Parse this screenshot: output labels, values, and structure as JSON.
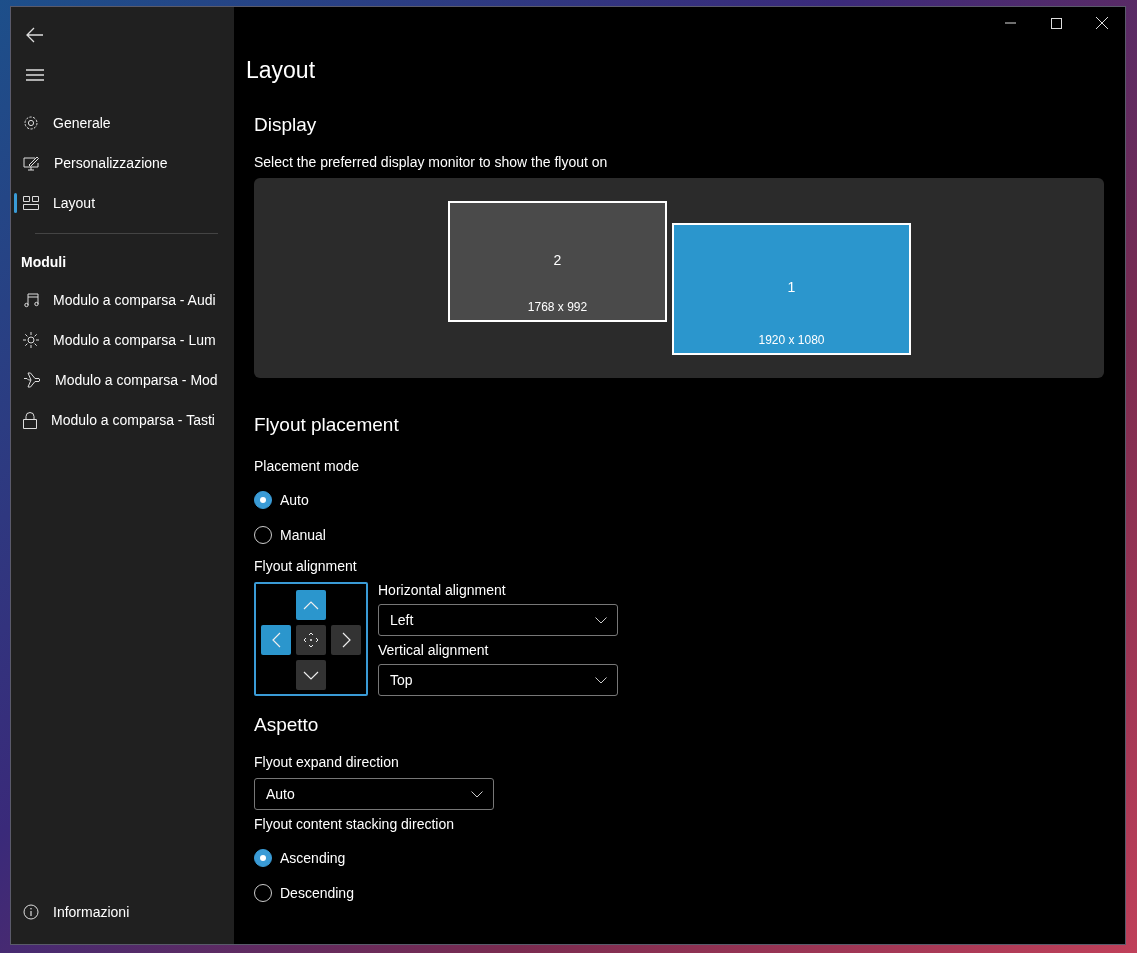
{
  "sidebar": {
    "nav_items": [
      {
        "label": "Generale",
        "kind": "gear",
        "selected": false
      },
      {
        "label": "Personalizzazione",
        "kind": "pen",
        "selected": false
      },
      {
        "label": "Layout",
        "kind": "layout",
        "selected": true
      }
    ],
    "section_label": "Moduli",
    "module_items": [
      {
        "label": "Modulo a comparsa - Audi",
        "kind": "music"
      },
      {
        "label": "Modulo a comparsa - Lum",
        "kind": "sun"
      },
      {
        "label": "Modulo a comparsa - Mod",
        "kind": "plane"
      },
      {
        "label": "Modulo a comparsa - Tasti",
        "kind": "lock"
      }
    ],
    "footer_item": {
      "label": "Informazioni"
    }
  },
  "page_title": "Layout",
  "display": {
    "heading": "Display",
    "description": "Select the preferred display monitor to show the flyout on",
    "monitors": [
      {
        "number": "2",
        "resolution": "1768 x 992",
        "selected": false
      },
      {
        "number": "1",
        "resolution": "1920 x 1080",
        "selected": true
      }
    ]
  },
  "flyout_placement": {
    "heading": "Flyout placement",
    "placement_mode_label": "Placement mode",
    "placement_modes": [
      {
        "label": "Auto",
        "selected": true
      },
      {
        "label": "Manual",
        "selected": false
      }
    ],
    "alignment_label": "Flyout alignment",
    "alignment_pad": [
      {
        "kind": "up",
        "selected": true
      },
      {
        "kind": "left",
        "selected": true
      },
      {
        "kind": "center",
        "selected": false
      },
      {
        "kind": "right",
        "selected": false
      },
      {
        "kind": "down",
        "selected": false
      }
    ],
    "horizontal": {
      "label": "Horizontal alignment",
      "value": "Left"
    },
    "vertical": {
      "label": "Vertical alignment",
      "value": "Top"
    }
  },
  "appearance": {
    "heading": "Aspetto",
    "expand_label": "Flyout expand direction",
    "expand_value": "Auto",
    "stacking_label": "Flyout content stacking direction",
    "stacking": [
      {
        "label": "Ascending",
        "selected": true
      },
      {
        "label": "Descending",
        "selected": false
      }
    ]
  }
}
